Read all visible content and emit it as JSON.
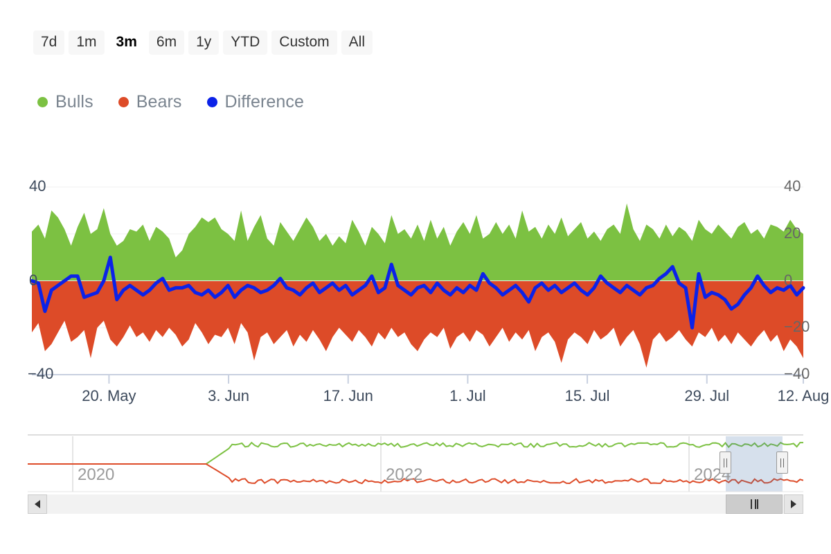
{
  "range_selector": {
    "buttons": [
      {
        "label": "7d",
        "selected": false
      },
      {
        "label": "1m",
        "selected": false
      },
      {
        "label": "3m",
        "selected": true
      },
      {
        "label": "6m",
        "selected": false
      },
      {
        "label": "1y",
        "selected": false
      },
      {
        "label": "YTD",
        "selected": false
      },
      {
        "label": "Custom",
        "selected": false
      },
      {
        "label": "All",
        "selected": false
      }
    ]
  },
  "legend": {
    "items": [
      {
        "label": "Bulls",
        "color": "#7cc142"
      },
      {
        "label": "Bears",
        "color": "#dd4b28"
      },
      {
        "label": "Difference",
        "color": "#0b22e8"
      }
    ]
  },
  "navigator": {
    "years": [
      "2020",
      "2022",
      "2024"
    ],
    "selection_label": "",
    "left_handle": "resize-left-handle",
    "right_handle": "resize-right-handle"
  },
  "scrollbar": {
    "left_arrow": "scroll-left",
    "right_arrow": "scroll-right",
    "thumb": "scrollbar-thumb"
  },
  "chart_data": {
    "type": "area",
    "title": "",
    "subtitle": "",
    "xlabel": "",
    "ylabel": "",
    "grid": true,
    "legend_position": "top-left",
    "ylim": [
      -40,
      40
    ],
    "y_ticks_left": [
      "40",
      "0",
      "−40"
    ],
    "y_ticks_left_values": [
      40,
      0,
      -40
    ],
    "y_ticks_right": [
      "40",
      "20",
      "0",
      "−20",
      "−40"
    ],
    "y_ticks_right_values": [
      40,
      20,
      0,
      -20,
      -40
    ],
    "x_tick_labels": [
      "20. May",
      "3. Jun",
      "17. Jun",
      "1. Jul",
      "15. Jul",
      "29. Jul",
      "12. Aug"
    ],
    "x_tick_positions": [
      0.1,
      0.255,
      0.41,
      0.565,
      0.72,
      0.875,
      1.0
    ],
    "series": [
      {
        "name": "Bulls",
        "color": "#7cc142",
        "render": "area",
        "values": [
          21,
          24,
          18,
          30,
          27,
          22,
          15,
          23,
          29,
          20,
          22,
          31,
          20,
          15,
          17,
          22,
          21,
          24,
          17,
          23,
          21,
          18,
          10,
          13,
          20,
          23,
          27,
          25,
          27,
          22,
          20,
          17,
          30,
          17,
          23,
          28,
          18,
          15,
          25,
          21,
          17,
          22,
          27,
          23,
          17,
          20,
          15,
          19,
          16,
          26,
          21,
          15,
          23,
          20,
          16,
          28,
          20,
          22,
          18,
          24,
          17,
          26,
          18,
          23,
          15,
          21,
          25,
          20,
          28,
          18,
          20,
          25,
          20,
          24,
          18,
          30,
          21,
          23,
          18,
          24,
          20,
          27,
          19,
          22,
          25,
          18,
          21,
          17,
          22,
          24,
          20,
          33,
          22,
          17,
          24,
          22,
          18,
          24,
          19,
          23,
          21,
          17,
          26,
          22,
          20,
          24,
          21,
          18,
          23,
          25,
          20,
          22,
          18,
          24,
          23,
          21,
          26,
          22,
          20
        ]
      },
      {
        "name": "Bears",
        "color": "#dd4b28",
        "render": "area",
        "values": [
          -22,
          -18,
          -30,
          -27,
          -22,
          -17,
          -26,
          -24,
          -21,
          -33,
          -20,
          -17,
          -25,
          -28,
          -24,
          -19,
          -24,
          -22,
          -26,
          -21,
          -24,
          -20,
          -23,
          -28,
          -25,
          -18,
          -22,
          -27,
          -23,
          -24,
          -20,
          -27,
          -18,
          -22,
          -34,
          -24,
          -22,
          -27,
          -24,
          -21,
          -28,
          -23,
          -26,
          -21,
          -25,
          -30,
          -24,
          -20,
          -23,
          -26,
          -21,
          -24,
          -28,
          -22,
          -25,
          -20,
          -24,
          -22,
          -27,
          -30,
          -25,
          -22,
          -24,
          -20,
          -29,
          -24,
          -22,
          -26,
          -21,
          -23,
          -28,
          -24,
          -20,
          -26,
          -22,
          -25,
          -21,
          -30,
          -24,
          -22,
          -26,
          -35,
          -25,
          -22,
          -24,
          -27,
          -21,
          -25,
          -23,
          -20,
          -28,
          -24,
          -21,
          -27,
          -37,
          -25,
          -22,
          -26,
          -24,
          -21,
          -25,
          -28,
          -22,
          -24,
          -20,
          -26,
          -23,
          -27,
          -22,
          -25,
          -28,
          -24,
          -21,
          -26,
          -23,
          -30,
          -25,
          -28,
          -33
        ]
      },
      {
        "name": "Difference",
        "color": "#0b22e8",
        "render": "line",
        "values": [
          0,
          -1,
          -13,
          -4,
          -2,
          0,
          2,
          2,
          -7,
          -6,
          -5,
          0,
          10,
          -8,
          -4,
          -2,
          -4,
          -6,
          -4,
          -1,
          1,
          -4,
          -3,
          -3,
          -2,
          -5,
          -6,
          -4,
          -7,
          -5,
          -2,
          -7,
          -4,
          -2,
          -3,
          -5,
          -4,
          -2,
          1,
          -3,
          -4,
          -6,
          -3,
          -1,
          -5,
          -3,
          -1,
          -4,
          -2,
          -6,
          -4,
          -2,
          2,
          -5,
          -3,
          7,
          -2,
          -4,
          -6,
          -3,
          -2,
          -5,
          -1,
          -4,
          -6,
          -3,
          -5,
          -2,
          -4,
          3,
          -1,
          -3,
          -6,
          -4,
          -2,
          -5,
          -9,
          -3,
          -1,
          -4,
          -2,
          -5,
          -3,
          -1,
          -4,
          -6,
          -3,
          2,
          -1,
          -3,
          -5,
          -2,
          -4,
          -6,
          -3,
          -2,
          1,
          3,
          6,
          -1,
          -3,
          -20,
          3,
          -7,
          -5,
          -6,
          -8,
          -12,
          -10,
          -6,
          -3,
          2,
          -2,
          -5,
          -3,
          -4,
          -2,
          -6,
          -3
        ]
      }
    ],
    "navigator_series": [
      {
        "name": "Bulls",
        "color": "#7cc142"
      },
      {
        "name": "Bears",
        "color": "#dd4b28"
      }
    ]
  }
}
